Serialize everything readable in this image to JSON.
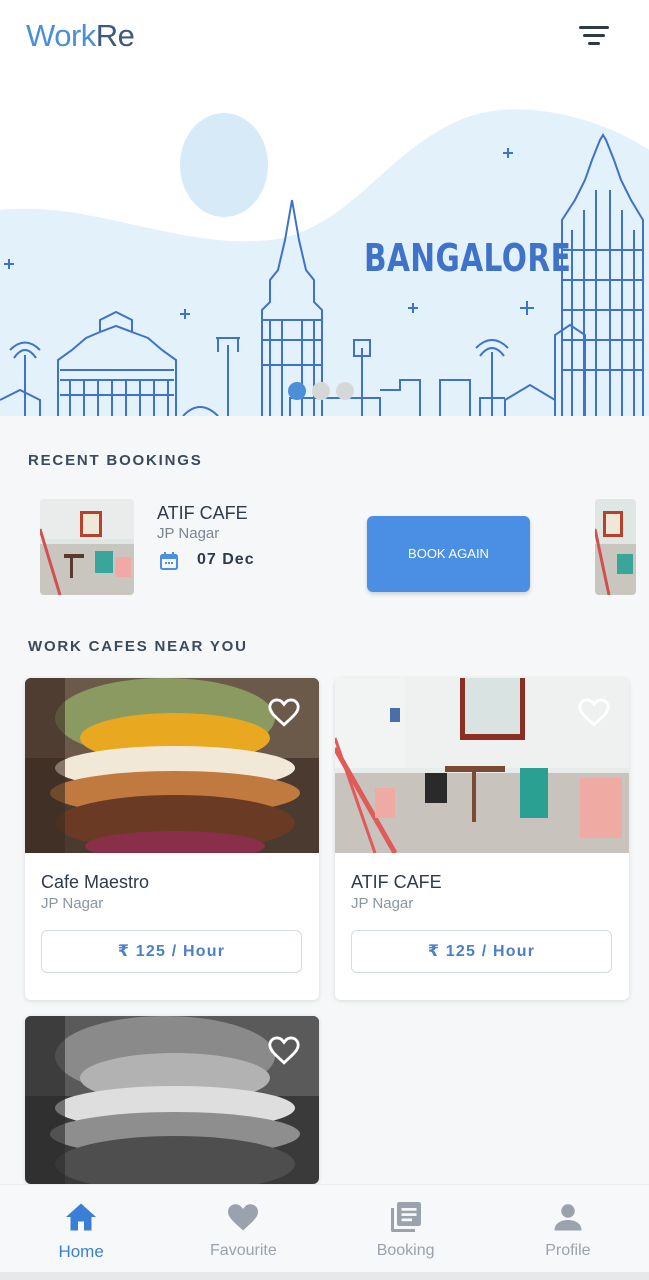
{
  "app": {
    "logo_part1": "Work",
    "logo_part2": "Re"
  },
  "hero": {
    "city": "BANGALORE",
    "slides_total": 3,
    "active_slide": 1
  },
  "recent_bookings": {
    "title": "RECENT BOOKINGS",
    "items": [
      {
        "name": "ATIF CAFE",
        "location": "JP Nagar",
        "date": "07 Dec",
        "action_label": "BOOK AGAIN"
      }
    ]
  },
  "nearby": {
    "title": "WORK CAFES NEAR YOU",
    "cafes": [
      {
        "name": "Cafe Maestro",
        "location": "JP Nagar",
        "price": "₹ 125 / Hour"
      },
      {
        "name": "ATIF CAFE",
        "location": "JP Nagar",
        "price": "₹ 125 / Hour"
      },
      {
        "name": "",
        "location": "",
        "price": ""
      }
    ]
  },
  "bottom_nav": {
    "items": [
      {
        "label": "Home",
        "icon": "home-icon",
        "active": true
      },
      {
        "label": "Favourite",
        "icon": "heart-icon",
        "active": false
      },
      {
        "label": "Booking",
        "icon": "booking-icon",
        "active": false
      },
      {
        "label": "Profile",
        "icon": "profile-icon",
        "active": false
      }
    ]
  },
  "colors": {
    "accent": "#4a8fe4",
    "active_nav": "#3a7fd6",
    "text_dark": "#2e3b4c",
    "text_muted": "#8a95a2",
    "hero_blue": "#3f73c9"
  }
}
